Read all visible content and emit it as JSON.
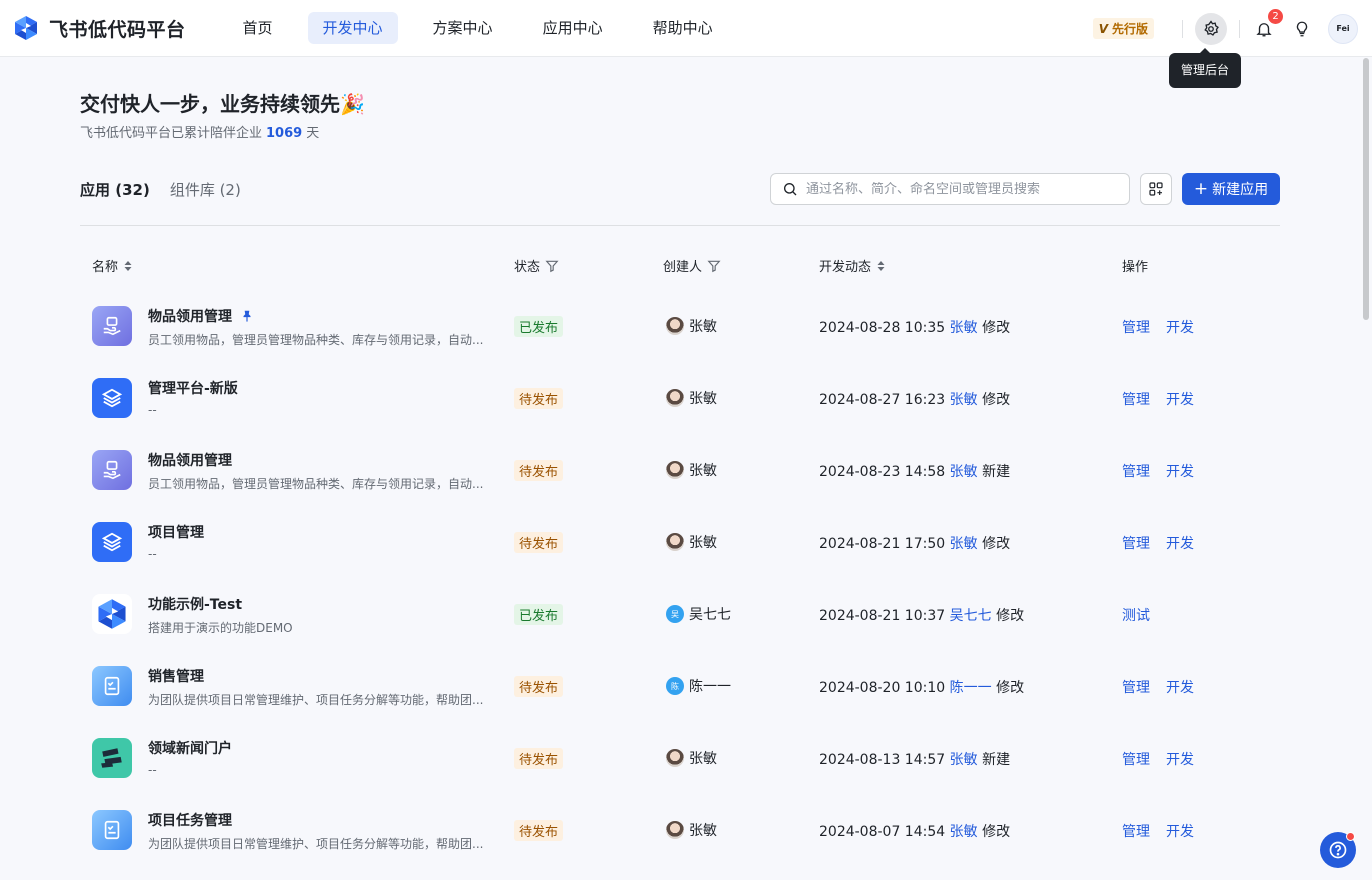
{
  "app": {
    "title": "飞书低代码平台"
  },
  "nav": {
    "items": [
      {
        "label": "首页"
      },
      {
        "label": "开发中心"
      },
      {
        "label": "方案中心"
      },
      {
        "label": "应用中心"
      },
      {
        "label": "帮助中心"
      }
    ],
    "active_index": 1
  },
  "header": {
    "beta_badge": "先行版",
    "beta_badge_prefix": "V",
    "notification_count": "2",
    "avatar_text": "Fei",
    "tooltip": "管理后台"
  },
  "hero": {
    "headline": "交付快人一步，业务持续领先🎉",
    "sub_prefix": "飞书低代码平台已累计陪伴企业",
    "days": "1069",
    "sub_suffix": "天"
  },
  "tabs": [
    {
      "label": "应用 (32)",
      "active": true
    },
    {
      "label": "组件库 (2)",
      "active": false
    }
  ],
  "search": {
    "placeholder": "通过名称、简介、命名空间或管理员搜索",
    "value": ""
  },
  "new_button": {
    "label": "新建应用",
    "icon": "plus-icon"
  },
  "table": {
    "columns": [
      "名称",
      "状态",
      "创建人",
      "开发动态",
      "操作"
    ],
    "rows": [
      {
        "name": "物品领用管理",
        "pinned": true,
        "desc": "员工领用物品，管理员管理物品种类、库存与领用记录，自动...",
        "icon": "hand-box-icon",
        "status": "已发布",
        "creator": "张敏",
        "creator_avatar": "photo",
        "time": "2024-08-28 10:35",
        "actor": "张敏",
        "action": "修改",
        "ops": [
          "管理",
          "开发"
        ]
      },
      {
        "name": "管理平台-新版",
        "pinned": false,
        "desc": "--",
        "icon": "layers-icon",
        "status": "待发布",
        "creator": "张敏",
        "creator_avatar": "photo",
        "time": "2024-08-27 16:23",
        "actor": "张敏",
        "action": "修改",
        "ops": [
          "管理",
          "开发"
        ]
      },
      {
        "name": "物品领用管理",
        "pinned": false,
        "desc": "员工领用物品，管理员管理物品种类、库存与领用记录，自动...",
        "icon": "hand-box-icon",
        "status": "待发布",
        "creator": "张敏",
        "creator_avatar": "photo",
        "time": "2024-08-23 14:58",
        "actor": "张敏",
        "action": "新建",
        "ops": [
          "管理",
          "开发"
        ]
      },
      {
        "name": "项目管理",
        "pinned": false,
        "desc": "--",
        "icon": "layers-icon",
        "status": "待发布",
        "creator": "张敏",
        "creator_avatar": "photo",
        "time": "2024-08-21 17:50",
        "actor": "张敏",
        "action": "修改",
        "ops": [
          "管理",
          "开发"
        ]
      },
      {
        "name": "功能示例-Test",
        "pinned": false,
        "desc": "搭建用于演示的功能DEMO",
        "icon": "logo-icon",
        "status": "已发布",
        "creator": "吴七七",
        "creator_avatar": "吴",
        "time": "2024-08-21 10:37",
        "actor": "吴七七",
        "action": "修改",
        "ops": [
          "测试"
        ]
      },
      {
        "name": "销售管理",
        "pinned": false,
        "desc": "为团队提供项目日常管理维护、项目任务分解等功能，帮助团...",
        "icon": "checklist-icon",
        "status": "待发布",
        "creator": "陈一一",
        "creator_avatar": "陈",
        "time": "2024-08-20 10:10",
        "actor": "陈一一",
        "action": "修改",
        "ops": [
          "管理",
          "开发"
        ]
      },
      {
        "name": "领域新闻门户",
        "pinned": false,
        "desc": "--",
        "icon": "news-icon",
        "status": "待发布",
        "creator": "张敏",
        "creator_avatar": "photo",
        "time": "2024-08-13 14:57",
        "actor": "张敏",
        "action": "新建",
        "ops": [
          "管理",
          "开发"
        ]
      },
      {
        "name": "项目任务管理",
        "pinned": false,
        "desc": "为团队提供项目日常管理维护、项目任务分解等功能，帮助团...",
        "icon": "checklist-icon",
        "status": "待发布",
        "creator": "张敏",
        "creator_avatar": "photo",
        "time": "2024-08-07 14:54",
        "actor": "张敏",
        "action": "修改",
        "ops": [
          "管理",
          "开发"
        ]
      }
    ]
  },
  "colors": {
    "accent": "#245bdb",
    "published_bg": "#e4f5e7",
    "pending_bg": "#fdf0e0"
  }
}
